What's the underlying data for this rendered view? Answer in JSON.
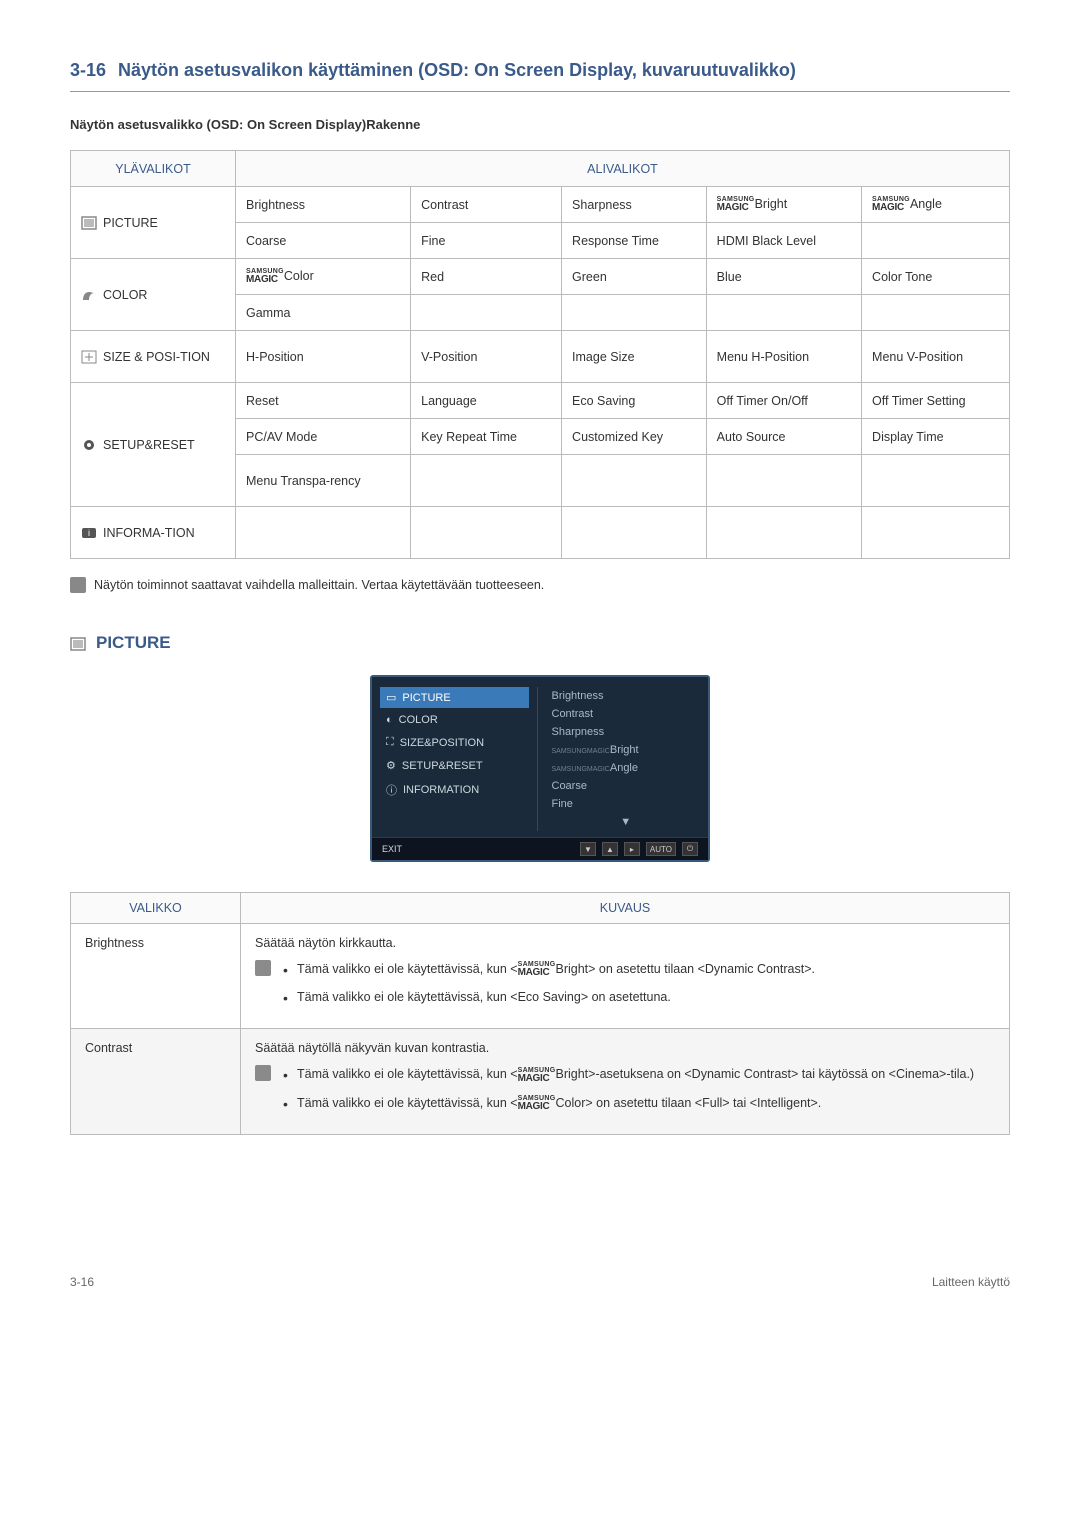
{
  "heading": {
    "num": "3-16",
    "title": "Näytön asetusvalikon käyttäminen (OSD: On Screen Display, kuvaruutuvalikko)"
  },
  "subheading": "Näytön asetusvalikko (OSD: On Screen Display)Rakenne",
  "table1": {
    "header": {
      "col1": "YLÄVALIKOT",
      "col2": "ALIVALIKOT"
    },
    "rows": {
      "picture": {
        "label": "PICTURE",
        "cells": [
          "Brightness",
          "Contrast",
          "Sharpness",
          "Bright",
          "Angle",
          "Coarse",
          "Fine",
          "Response Time",
          "HDMI Black Level",
          ""
        ]
      },
      "color": {
        "label": "COLOR",
        "cells": [
          "Color",
          "Red",
          "Green",
          "Blue",
          "Color Tone",
          "Gamma",
          "",
          "",
          "",
          ""
        ]
      },
      "size": {
        "label": "SIZE & POSI-TION",
        "cells": [
          "H-Position",
          "V-Position",
          "Image Size",
          "Menu H-Position",
          "Menu V-Position"
        ]
      },
      "setup": {
        "label": "SETUP&RESET",
        "cells": [
          "Reset",
          "Language",
          "Eco Saving",
          "Off Timer On/Off",
          "Off Timer Setting",
          "PC/AV Mode",
          "Key Repeat Time",
          "Customized Key",
          "Auto Source",
          "Display Time",
          "Menu Transpa-rency",
          "",
          "",
          "",
          ""
        ]
      },
      "info": {
        "label": "INFORMA-TION",
        "cells": [
          "",
          "",
          "",
          "",
          ""
        ]
      }
    }
  },
  "note": "Näytön toiminnot saattavat vaihdella malleittain. Vertaa käytettävään tuotteeseen.",
  "sec2_heading": "PICTURE",
  "screenshot": {
    "left": [
      "PICTURE",
      "COLOR",
      "SIZE&POSITION",
      "SETUP&RESET",
      "INFORMATION"
    ],
    "right": [
      "Brightness",
      "Contrast",
      "Sharpness",
      "Bright",
      "Angle",
      "Coarse",
      "Fine"
    ],
    "footer": {
      "exit": "EXIT",
      "auto": "AUTO"
    }
  },
  "table2": {
    "header": {
      "col1": "VALIKKO",
      "col2": "KUVAUS"
    },
    "rows": [
      {
        "label": "Brightness",
        "intro": "Säätää näytön kirkkautta.",
        "bullets": [
          {
            "pre": "Tämä valikko ei ole käytettävissä, kun <",
            "magic": true,
            "post": "Bright> on asetettu tilaan <Dynamic Contrast>."
          },
          {
            "pre": "Tämä valikko ei ole käytettävissä, kun <Eco Saving> on asetettuna.",
            "magic": false,
            "post": ""
          }
        ],
        "hasIcon": true
      },
      {
        "label": "Contrast",
        "intro": "Säätää näytöllä näkyvän kuvan kontrastia.",
        "bullets": [
          {
            "pre": "Tämä valikko ei ole käytettävissä, kun <",
            "magic": true,
            "post": "Bright>-asetuksena on <Dynamic Contrast> tai käytössä on <Cinema>-tila.)"
          },
          {
            "pre": "Tämä valikko ei ole käytettävissä, kun <",
            "magic": true,
            "post": "Color> on asetettu tilaan <Full> tai <Intelligent>."
          }
        ],
        "hasIcon": true
      }
    ]
  },
  "footer": {
    "left": "3-16",
    "right": "Laitteen käyttö"
  },
  "magic": {
    "s": "SAMSUNG",
    "m": "MAGIC"
  }
}
